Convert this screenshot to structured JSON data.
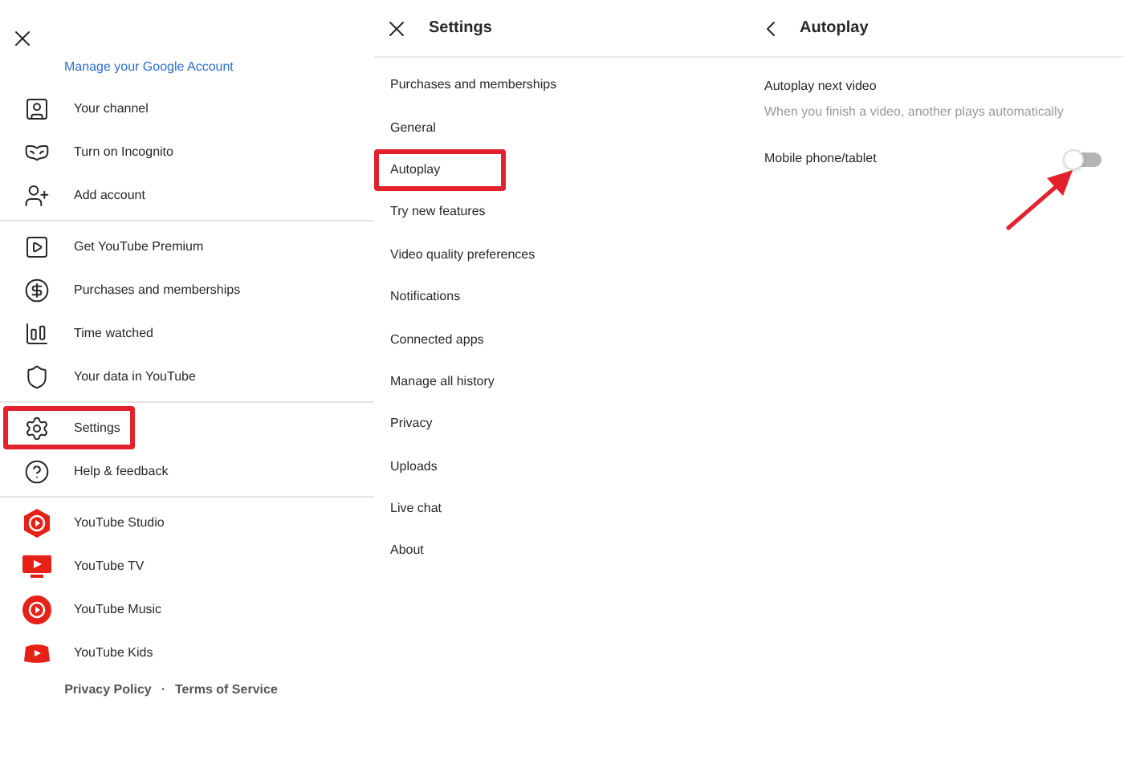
{
  "account_panel": {
    "manage_link": "Manage your Google Account",
    "groups": [
      {
        "items": [
          {
            "kind": "channel",
            "label": "Your channel",
            "highlighted": false
          },
          {
            "kind": "incognito",
            "label": "Turn on Incognito",
            "highlighted": false
          },
          {
            "kind": "addaccount",
            "label": "Add account",
            "highlighted": false
          }
        ]
      },
      {
        "items": [
          {
            "kind": "premium",
            "label": "Get YouTube Premium",
            "highlighted": false
          },
          {
            "kind": "purchases",
            "label": "Purchases and memberships",
            "highlighted": false
          },
          {
            "kind": "time",
            "label": "Time watched",
            "highlighted": false
          },
          {
            "kind": "data",
            "label": "Your data in YouTube",
            "highlighted": false
          }
        ]
      },
      {
        "items": [
          {
            "kind": "settings",
            "label": "Settings",
            "highlighted": true
          },
          {
            "kind": "help",
            "label": "Help & feedback",
            "highlighted": false
          }
        ]
      },
      {
        "items": [
          {
            "kind": "studio",
            "label": "YouTube Studio",
            "highlighted": false
          },
          {
            "kind": "tv",
            "label": "YouTube TV",
            "highlighted": false
          },
          {
            "kind": "music",
            "label": "YouTube Music",
            "highlighted": false
          },
          {
            "kind": "kids",
            "label": "YouTube Kids",
            "highlighted": false
          }
        ]
      }
    ],
    "footer": {
      "privacy": "Privacy Policy",
      "separator": "·",
      "terms": "Terms of Service"
    }
  },
  "settings_panel": {
    "title": "Settings",
    "items": [
      {
        "label": "Purchases and memberships",
        "highlighted": false
      },
      {
        "label": "General",
        "highlighted": false
      },
      {
        "label": "Autoplay",
        "highlighted": true
      },
      {
        "label": "Try new features",
        "highlighted": false
      },
      {
        "label": "Video quality preferences",
        "highlighted": false
      },
      {
        "label": "Notifications",
        "highlighted": false
      },
      {
        "label": "Connected apps",
        "highlighted": false
      },
      {
        "label": "Manage all history",
        "highlighted": false
      },
      {
        "label": "Privacy",
        "highlighted": false
      },
      {
        "label": "Uploads",
        "highlighted": false
      },
      {
        "label": "Live chat",
        "highlighted": false
      },
      {
        "label": "About",
        "highlighted": false
      }
    ]
  },
  "autoplay_panel": {
    "title": "Autoplay",
    "section_title": "Autoplay next video",
    "section_description": "When you finish a video, another plays automatically",
    "toggle": {
      "label": "Mobile phone/tablet",
      "on": false,
      "annotated": true
    }
  }
}
